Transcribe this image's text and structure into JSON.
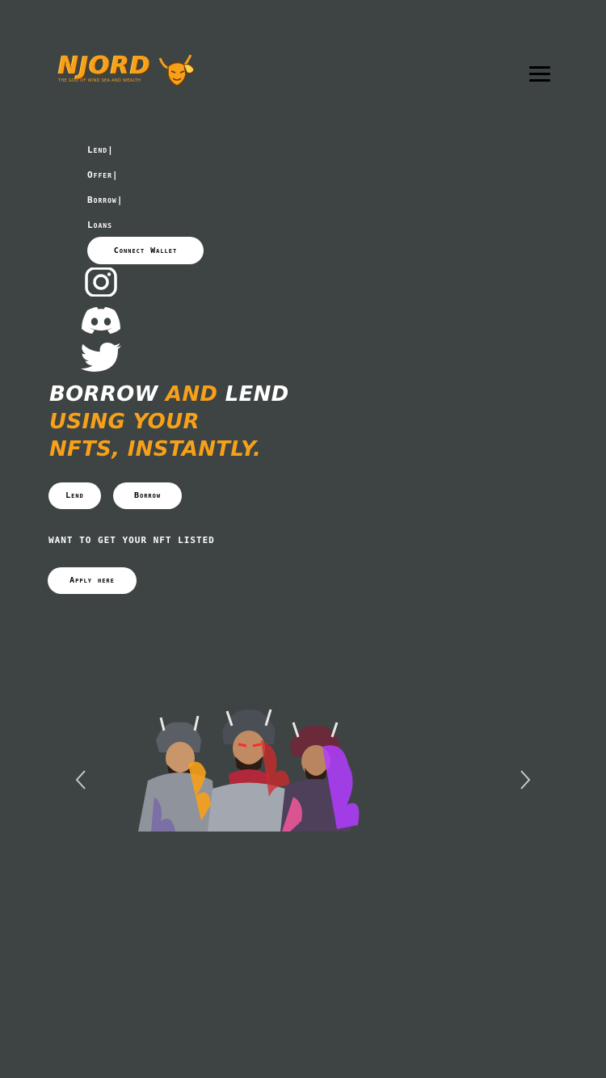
{
  "brand": {
    "name": "NJORD",
    "tagline": "THE GOD OF WIND SEA AND WEALTH"
  },
  "nav": {
    "items": [
      {
        "label": "Lend|"
      },
      {
        "label": "Offer|"
      },
      {
        "label": "Borrow|"
      },
      {
        "label": "Loans"
      }
    ],
    "connect_label": "Connect Wallet"
  },
  "social": {
    "icons": [
      "instagram-icon",
      "discord-icon",
      "twitter-icon"
    ]
  },
  "hero": {
    "word_borrow": "BORROW",
    "word_and": "AND",
    "word_lend": "LEND",
    "line2": "USING YOUR",
    "line3": "NFTS, INSTANTLY."
  },
  "actions": {
    "lend_label": "Lend",
    "borrow_label": "Borrow",
    "want_text": "want to get your nft listed",
    "apply_label": "Apply here"
  },
  "carousel": {
    "prev_icon": "chevron-left-icon",
    "next_icon": "chevron-right-icon"
  },
  "colors": {
    "background": "#3d4443",
    "accent": "#f7a019",
    "text": "#ffffff"
  }
}
